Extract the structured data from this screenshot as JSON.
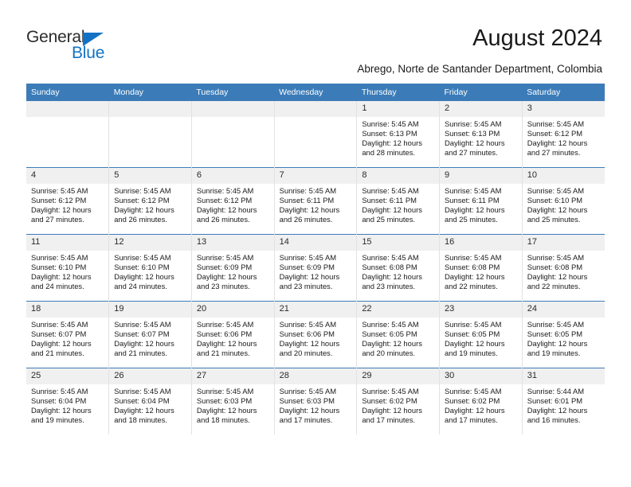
{
  "brand": {
    "name_top": "General",
    "name_bottom": "Blue",
    "triangle_icon": "triangle-icon",
    "accent_color": "#1372c4"
  },
  "header": {
    "title": "August 2024",
    "subtitle": "Abrego, Norte de Santander Department, Colombia"
  },
  "calendar": {
    "header_bg": "#3b7cb8",
    "daynum_bg": "#f0f0f0",
    "weekday_headers": [
      "Sunday",
      "Monday",
      "Tuesday",
      "Wednesday",
      "Thursday",
      "Friday",
      "Saturday"
    ],
    "weeks": [
      [
        {
          "day": "",
          "empty": true
        },
        {
          "day": "",
          "empty": true
        },
        {
          "day": "",
          "empty": true
        },
        {
          "day": "",
          "empty": true
        },
        {
          "day": "1",
          "sunrise": "Sunrise: 5:45 AM",
          "sunset": "Sunset: 6:13 PM",
          "daylight": "Daylight: 12 hours and 28 minutes."
        },
        {
          "day": "2",
          "sunrise": "Sunrise: 5:45 AM",
          "sunset": "Sunset: 6:13 PM",
          "daylight": "Daylight: 12 hours and 27 minutes."
        },
        {
          "day": "3",
          "sunrise": "Sunrise: 5:45 AM",
          "sunset": "Sunset: 6:12 PM",
          "daylight": "Daylight: 12 hours and 27 minutes."
        }
      ],
      [
        {
          "day": "4",
          "sunrise": "Sunrise: 5:45 AM",
          "sunset": "Sunset: 6:12 PM",
          "daylight": "Daylight: 12 hours and 27 minutes."
        },
        {
          "day": "5",
          "sunrise": "Sunrise: 5:45 AM",
          "sunset": "Sunset: 6:12 PM",
          "daylight": "Daylight: 12 hours and 26 minutes."
        },
        {
          "day": "6",
          "sunrise": "Sunrise: 5:45 AM",
          "sunset": "Sunset: 6:12 PM",
          "daylight": "Daylight: 12 hours and 26 minutes."
        },
        {
          "day": "7",
          "sunrise": "Sunrise: 5:45 AM",
          "sunset": "Sunset: 6:11 PM",
          "daylight": "Daylight: 12 hours and 26 minutes."
        },
        {
          "day": "8",
          "sunrise": "Sunrise: 5:45 AM",
          "sunset": "Sunset: 6:11 PM",
          "daylight": "Daylight: 12 hours and 25 minutes."
        },
        {
          "day": "9",
          "sunrise": "Sunrise: 5:45 AM",
          "sunset": "Sunset: 6:11 PM",
          "daylight": "Daylight: 12 hours and 25 minutes."
        },
        {
          "day": "10",
          "sunrise": "Sunrise: 5:45 AM",
          "sunset": "Sunset: 6:10 PM",
          "daylight": "Daylight: 12 hours and 25 minutes."
        }
      ],
      [
        {
          "day": "11",
          "sunrise": "Sunrise: 5:45 AM",
          "sunset": "Sunset: 6:10 PM",
          "daylight": "Daylight: 12 hours and 24 minutes."
        },
        {
          "day": "12",
          "sunrise": "Sunrise: 5:45 AM",
          "sunset": "Sunset: 6:10 PM",
          "daylight": "Daylight: 12 hours and 24 minutes."
        },
        {
          "day": "13",
          "sunrise": "Sunrise: 5:45 AM",
          "sunset": "Sunset: 6:09 PM",
          "daylight": "Daylight: 12 hours and 23 minutes."
        },
        {
          "day": "14",
          "sunrise": "Sunrise: 5:45 AM",
          "sunset": "Sunset: 6:09 PM",
          "daylight": "Daylight: 12 hours and 23 minutes."
        },
        {
          "day": "15",
          "sunrise": "Sunrise: 5:45 AM",
          "sunset": "Sunset: 6:08 PM",
          "daylight": "Daylight: 12 hours and 23 minutes."
        },
        {
          "day": "16",
          "sunrise": "Sunrise: 5:45 AM",
          "sunset": "Sunset: 6:08 PM",
          "daylight": "Daylight: 12 hours and 22 minutes."
        },
        {
          "day": "17",
          "sunrise": "Sunrise: 5:45 AM",
          "sunset": "Sunset: 6:08 PM",
          "daylight": "Daylight: 12 hours and 22 minutes."
        }
      ],
      [
        {
          "day": "18",
          "sunrise": "Sunrise: 5:45 AM",
          "sunset": "Sunset: 6:07 PM",
          "daylight": "Daylight: 12 hours and 21 minutes."
        },
        {
          "day": "19",
          "sunrise": "Sunrise: 5:45 AM",
          "sunset": "Sunset: 6:07 PM",
          "daylight": "Daylight: 12 hours and 21 minutes."
        },
        {
          "day": "20",
          "sunrise": "Sunrise: 5:45 AM",
          "sunset": "Sunset: 6:06 PM",
          "daylight": "Daylight: 12 hours and 21 minutes."
        },
        {
          "day": "21",
          "sunrise": "Sunrise: 5:45 AM",
          "sunset": "Sunset: 6:06 PM",
          "daylight": "Daylight: 12 hours and 20 minutes."
        },
        {
          "day": "22",
          "sunrise": "Sunrise: 5:45 AM",
          "sunset": "Sunset: 6:05 PM",
          "daylight": "Daylight: 12 hours and 20 minutes."
        },
        {
          "day": "23",
          "sunrise": "Sunrise: 5:45 AM",
          "sunset": "Sunset: 6:05 PM",
          "daylight": "Daylight: 12 hours and 19 minutes."
        },
        {
          "day": "24",
          "sunrise": "Sunrise: 5:45 AM",
          "sunset": "Sunset: 6:05 PM",
          "daylight": "Daylight: 12 hours and 19 minutes."
        }
      ],
      [
        {
          "day": "25",
          "sunrise": "Sunrise: 5:45 AM",
          "sunset": "Sunset: 6:04 PM",
          "daylight": "Daylight: 12 hours and 19 minutes."
        },
        {
          "day": "26",
          "sunrise": "Sunrise: 5:45 AM",
          "sunset": "Sunset: 6:04 PM",
          "daylight": "Daylight: 12 hours and 18 minutes."
        },
        {
          "day": "27",
          "sunrise": "Sunrise: 5:45 AM",
          "sunset": "Sunset: 6:03 PM",
          "daylight": "Daylight: 12 hours and 18 minutes."
        },
        {
          "day": "28",
          "sunrise": "Sunrise: 5:45 AM",
          "sunset": "Sunset: 6:03 PM",
          "daylight": "Daylight: 12 hours and 17 minutes."
        },
        {
          "day": "29",
          "sunrise": "Sunrise: 5:45 AM",
          "sunset": "Sunset: 6:02 PM",
          "daylight": "Daylight: 12 hours and 17 minutes."
        },
        {
          "day": "30",
          "sunrise": "Sunrise: 5:45 AM",
          "sunset": "Sunset: 6:02 PM",
          "daylight": "Daylight: 12 hours and 17 minutes."
        },
        {
          "day": "31",
          "sunrise": "Sunrise: 5:44 AM",
          "sunset": "Sunset: 6:01 PM",
          "daylight": "Daylight: 12 hours and 16 minutes."
        }
      ]
    ]
  }
}
